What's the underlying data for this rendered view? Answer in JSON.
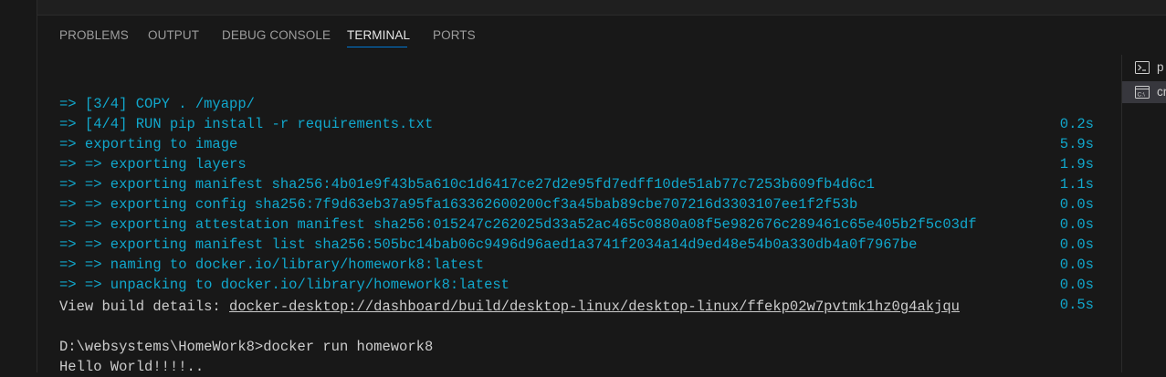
{
  "tabs": [
    {
      "label": "PROBLEMS"
    },
    {
      "label": "OUTPUT"
    },
    {
      "label": "DEBUG CONSOLE"
    },
    {
      "label": "TERMINAL"
    },
    {
      "label": "PORTS"
    }
  ],
  "active_tab": "TERMINAL",
  "terminal": {
    "build_lines": [
      {
        "text": "=> [3/4] COPY . /myapp/",
        "time": "0.2s"
      },
      {
        "text": "=> [4/4] RUN pip install -r requirements.txt",
        "time": "5.9s"
      },
      {
        "text": "=> exporting to image",
        "time": "1.9s"
      },
      {
        "text": "=> => exporting layers",
        "time": "1.1s"
      },
      {
        "text": "=> => exporting manifest sha256:4b01e9f43b5a610c1d6417ce27d2e95fd7edff10de51ab77c7253b609fb4d6c1",
        "time": "0.0s"
      },
      {
        "text": "=> => exporting config sha256:7f9d63eb37a95fa163362600200cf3a45bab89cbe707216d3303107ee1f2f53b",
        "time": "0.0s"
      },
      {
        "text": "=> => exporting attestation manifest sha256:015247c262025d33a52ac465c0880a08f5e982676c289461c65e405b2f5c03df",
        "time": "0.0s"
      },
      {
        "text": "=> => exporting manifest list sha256:505bc14bab06c9496d96aed1a3741f2034a14d9ed48e54b0a330db4a0f7967be",
        "time": "0.0s"
      },
      {
        "text": "=> => naming to docker.io/library/homework8:latest",
        "time": "0.0s"
      },
      {
        "text": "=> => unpacking to docker.io/library/homework8:latest",
        "time": "0.5s"
      }
    ],
    "view_details_prefix": "View build details: ",
    "view_details_link": "docker-desktop://dashboard/build/desktop-linux/desktop-linux/ffekp02w7pvtmk1hz0g4akjqu",
    "prompt_line": "D:\\websystems\\HomeWork8>docker run homework8",
    "output_line": "Hello World!!!!.."
  },
  "terminal_list": [
    {
      "label": "p",
      "icon": "powershell-icon"
    },
    {
      "label": "cr",
      "icon": "cmd-icon"
    }
  ],
  "colors": {
    "cyan": "#11a8cd",
    "text": "#cccccc",
    "accent": "#0078d4",
    "background": "#181818"
  }
}
